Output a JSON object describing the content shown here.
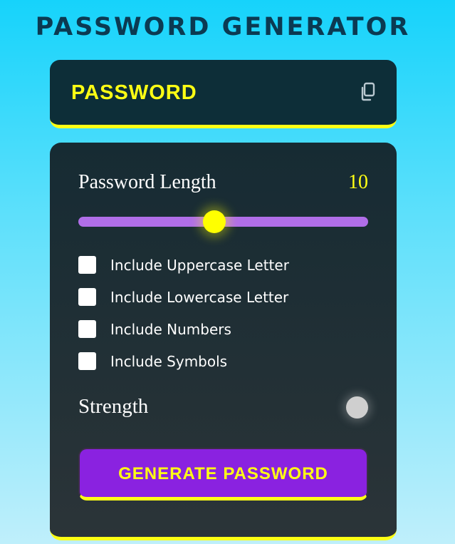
{
  "app": {
    "title": "PASSWORD GENERATOR"
  },
  "display": {
    "password_placeholder": "PASSWORD",
    "copy_icon": "copy-icon"
  },
  "length": {
    "label": "Password Length",
    "value": "10",
    "slider_fraction": 0.47
  },
  "options": [
    {
      "label": "Include Uppercase Letter",
      "checked": false
    },
    {
      "label": "Include Lowercase Letter",
      "checked": false
    },
    {
      "label": "Include Numbers",
      "checked": false
    },
    {
      "label": "Include Symbols",
      "checked": false
    }
  ],
  "strength": {
    "label": "Strength",
    "indicator_color": "#cfcfcf"
  },
  "generate": {
    "label": "GENERATE PASSWORD"
  },
  "colors": {
    "accent": "#ffff14",
    "panel": "#1c2e35",
    "button": "#8a22e0",
    "slider": "#b06ee8",
    "title": "#0b3a52"
  }
}
